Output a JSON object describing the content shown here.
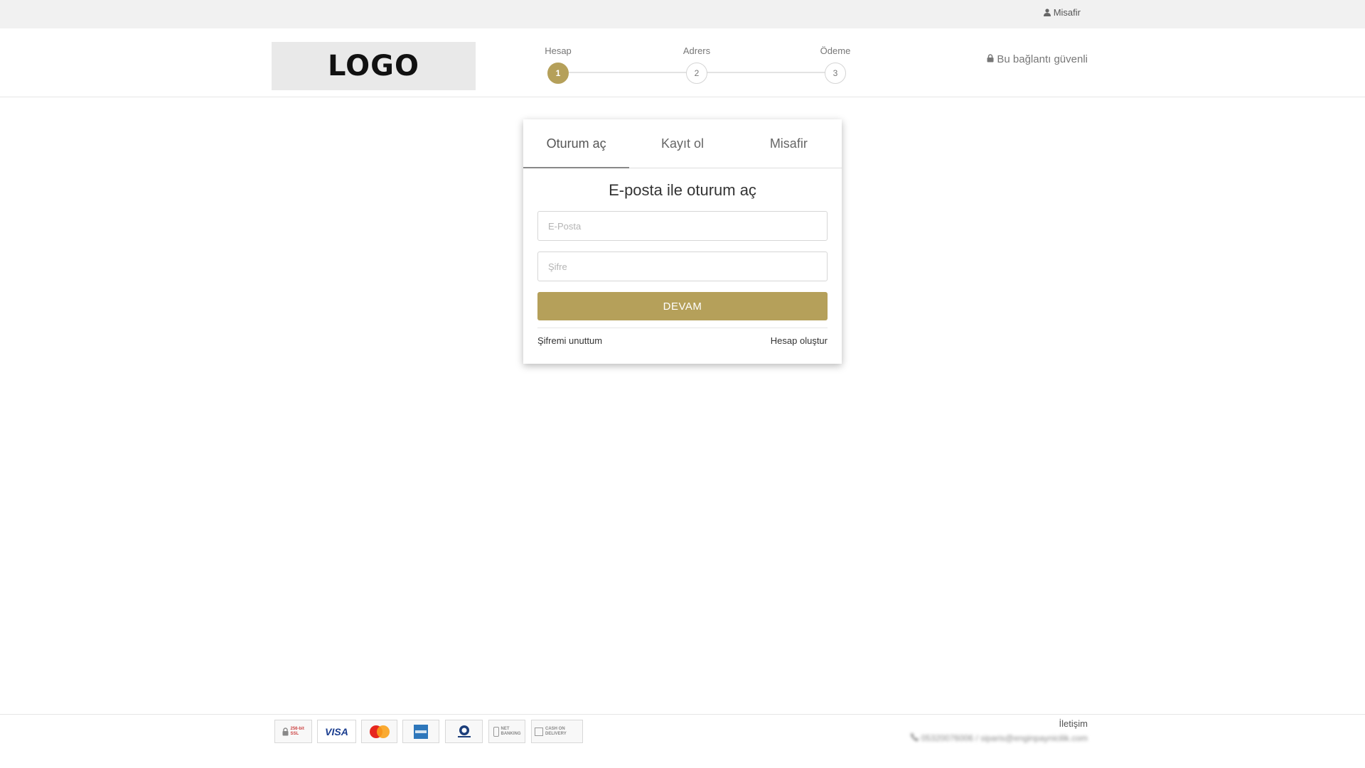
{
  "topbar": {
    "user_label": "Misafir"
  },
  "header": {
    "logo_text": "LOGO",
    "steps": [
      {
        "label": "Hesap",
        "number": "1",
        "active": true
      },
      {
        "label": "Adrers",
        "number": "2",
        "active": false
      },
      {
        "label": "Ödeme",
        "number": "3",
        "active": false
      }
    ],
    "secure_text": "Bu bağlantı güvenli"
  },
  "login": {
    "tabs": [
      {
        "label": "Oturum aç",
        "active": true
      },
      {
        "label": "Kayıt ol",
        "active": false
      },
      {
        "label": "Misafir",
        "active": false
      }
    ],
    "title": "E-posta ile oturum aç",
    "email_placeholder": "E-Posta",
    "password_placeholder": "Şifre",
    "submit_label": "DEVAM",
    "forgot_link": "Şifremi unuttum",
    "create_link": "Hesap oluştur"
  },
  "footer": {
    "payment_icons": [
      "256-bit SSL",
      "VISA",
      "MasterCard",
      "American Express",
      "Diners Club International",
      "NET BANKING",
      "CASH ON DELIVERY"
    ],
    "ssl_text": "256-bit SSL",
    "visa_text": "VISA",
    "netbanking_text": "NET BANKING",
    "cod_text": "CASH ON DELIVERY",
    "contact_title": "İletişim",
    "contact_line": "05320076006 / siparis@enginpaynicilik.com"
  },
  "colors": {
    "accent": "#b5a05a",
    "topbar_bg": "#f1f1f1"
  }
}
